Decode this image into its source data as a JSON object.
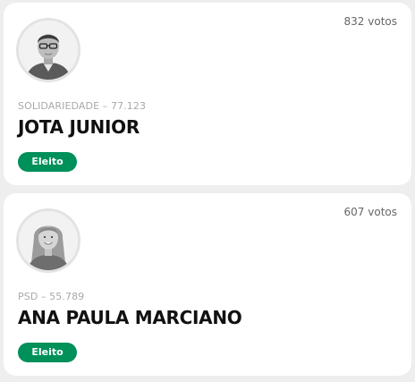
{
  "colors": {
    "badge_background": "#00905a",
    "card_background": "#ffffff",
    "page_background": "#eeeeee"
  },
  "candidates": [
    {
      "votes": "832 votos",
      "party_line": "SOLIDARIEDADE – 77.123",
      "name": "JOTA JUNIOR",
      "status": "Eleito",
      "photo_icon": "man-portrait"
    },
    {
      "votes": "607 votos",
      "party_line": "PSD – 55.789",
      "name": "ANA PAULA MARCIANO",
      "status": "Eleito",
      "photo_icon": "woman-portrait"
    }
  ]
}
